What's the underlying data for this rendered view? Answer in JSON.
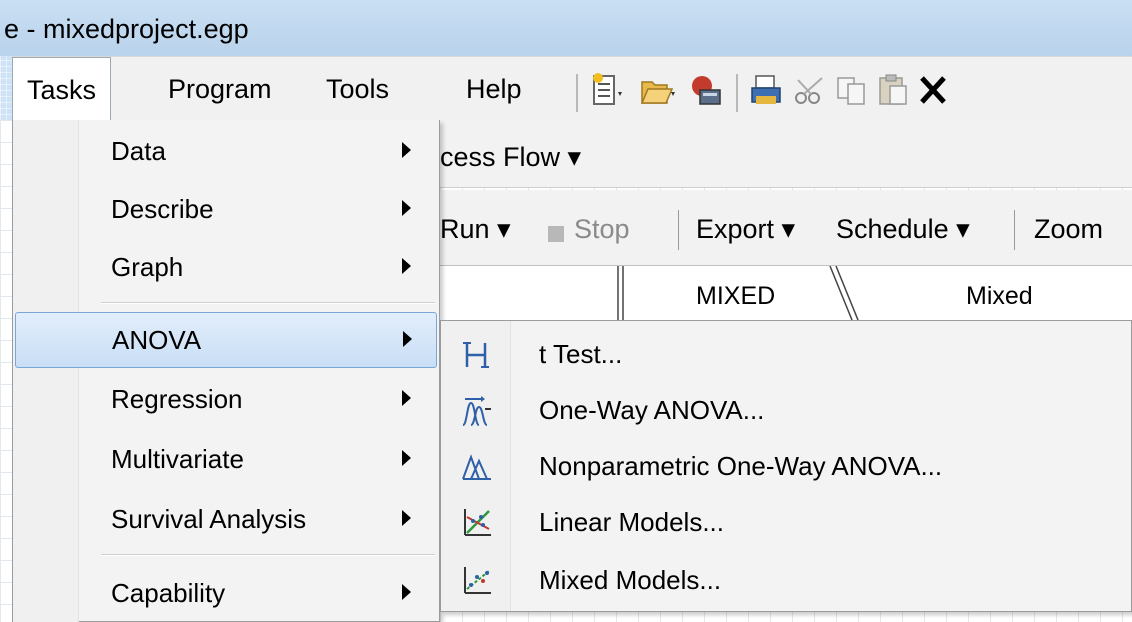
{
  "window": {
    "title": "e - mixedproject.egp"
  },
  "menubar": {
    "items": [
      {
        "label": "Tasks"
      },
      {
        "label": "Program"
      },
      {
        "label": "Tools"
      },
      {
        "label": "Help"
      }
    ]
  },
  "toolbar": {
    "icons": [
      "new-file-icon",
      "open-folder-icon",
      "sas-server-icon",
      "print-icon",
      "cut-icon",
      "copy-icon",
      "paste-icon",
      "delete-icon"
    ]
  },
  "process_flow": {
    "label": "cess Flow ▾"
  },
  "run_toolbar": {
    "run_label": "Run ▾",
    "stop_label": "Stop",
    "export_label": "Export ▾",
    "schedule_label": "Schedule ▾",
    "zoom_label": "Zoom"
  },
  "flow_columns": {
    "col1": "MIXED",
    "col2": "Mixed"
  },
  "tasks_menu": {
    "items": [
      {
        "label": "Data"
      },
      {
        "label": "Describe"
      },
      {
        "label": "Graph"
      },
      {
        "label": "ANOVA"
      },
      {
        "label": "Regression"
      },
      {
        "label": "Multivariate"
      },
      {
        "label": "Survival Analysis"
      },
      {
        "label": "Capability"
      }
    ],
    "highlighted": "ANOVA"
  },
  "anova_submenu": {
    "items": [
      {
        "label": "t Test...",
        "icon": "t-test-icon"
      },
      {
        "label": "One-Way ANOVA...",
        "icon": "one-way-anova-icon"
      },
      {
        "label": "Nonparametric One-Way ANOVA...",
        "icon": "nonparametric-anova-icon"
      },
      {
        "label": "Linear Models...",
        "icon": "linear-models-icon"
      },
      {
        "label": "Mixed Models...",
        "icon": "mixed-models-icon"
      }
    ]
  }
}
